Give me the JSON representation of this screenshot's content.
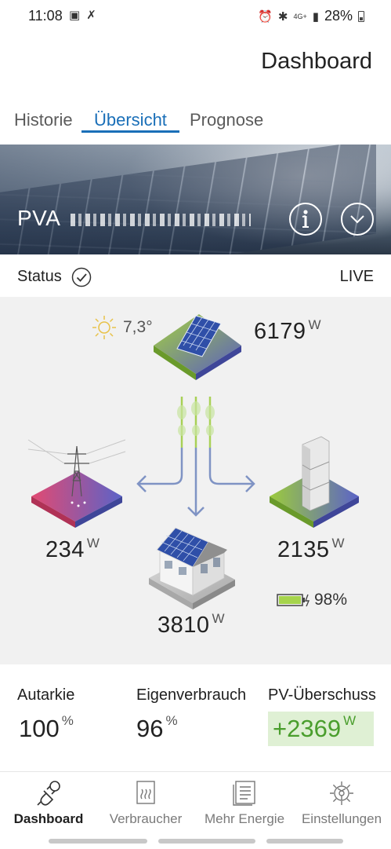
{
  "status_bar": {
    "time": "11:08",
    "network": "4G+",
    "battery_percent": "28%"
  },
  "header": {
    "title": "Dashboard"
  },
  "tabs": [
    {
      "label": "Historie",
      "active": false
    },
    {
      "label": "Übersicht",
      "active": true
    },
    {
      "label": "Prognose",
      "active": false
    }
  ],
  "banner": {
    "plant_prefix": "PVA"
  },
  "status": {
    "label": "Status",
    "mode": "LIVE"
  },
  "weather": {
    "temperature": "7,3°",
    "icon": "sun-icon"
  },
  "flow": {
    "pv": {
      "value": "6179",
      "unit": "W"
    },
    "grid": {
      "value": "234",
      "unit": "W"
    },
    "house": {
      "value": "3810",
      "unit": "W"
    },
    "battery": {
      "value": "2135",
      "unit": "W",
      "charge": "98%"
    }
  },
  "stats": {
    "autarkie": {
      "label": "Autarkie",
      "value": "100",
      "unit": "%"
    },
    "eigenverbrauch": {
      "label": "Eigenverbrauch",
      "value": "96",
      "unit": "%"
    },
    "pv_ueberschuss": {
      "label": "PV-Überschuss",
      "value": "+2369",
      "unit": "W",
      "color": "#4a9e2d"
    }
  },
  "nav": [
    {
      "label": "Dashboard",
      "icon": "plug-icon",
      "active": true
    },
    {
      "label": "Verbraucher",
      "icon": "heater-icon",
      "active": false
    },
    {
      "label": "Mehr Energie",
      "icon": "document-icon",
      "active": false
    },
    {
      "label": "Einstellungen",
      "icon": "gear-icon",
      "active": false
    }
  ],
  "colors": {
    "accent": "#1a6fb8",
    "flow_arrow": "#7f93c4",
    "pv_green": "#8cc43c"
  }
}
